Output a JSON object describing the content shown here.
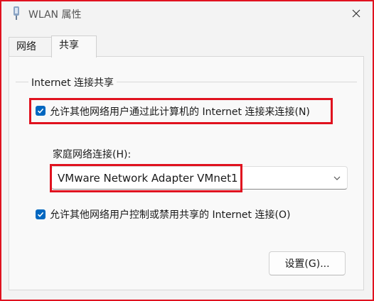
{
  "window": {
    "title": "WLAN 属性"
  },
  "tabs": [
    {
      "label": "网络",
      "active": false
    },
    {
      "label": "共享",
      "active": true
    }
  ],
  "sharing": {
    "group_title": "Internet 连接共享",
    "allow_others_connect": {
      "label": "允许其他网络用户通过此计算机的 Internet 连接来连接(N)",
      "checked": true
    },
    "home_network_label": "家庭网络连接(H):",
    "home_network_value": "VMware Network Adapter VMnet1",
    "allow_others_control": {
      "label": "允许其他网络用户控制或禁用共享的 Internet 连接(O)",
      "checked": true
    },
    "settings_button": "设置(G)..."
  },
  "colors": {
    "accent": "#0067c0",
    "highlight": "#e0121f"
  }
}
